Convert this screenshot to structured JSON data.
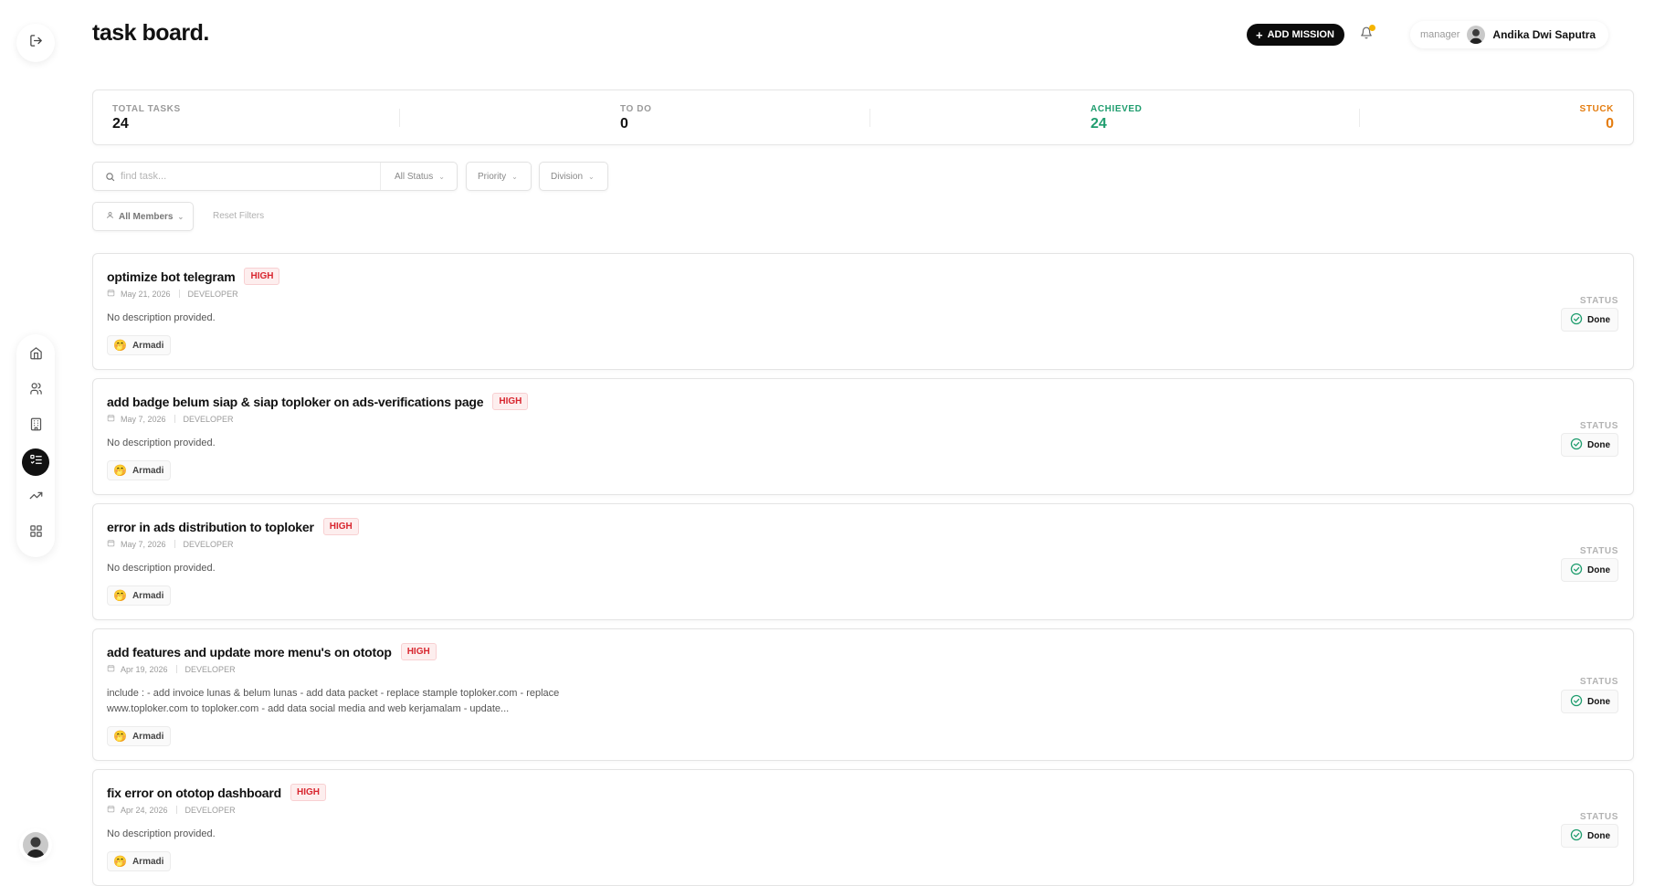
{
  "header": {
    "title": "task board.",
    "add_button": "ADD MISSION",
    "user_role": "manager",
    "user_name": "Andika Dwi Saputra"
  },
  "stats": {
    "total_label": "TOTAL TASKS",
    "total_value": "24",
    "todo_label": "TO DO",
    "todo_value": "0",
    "achieved_label": "ACHIEVED",
    "achieved_value": "24",
    "stuck_label": "STUCK",
    "stuck_value": "0"
  },
  "filters": {
    "search_placeholder": "find task...",
    "status": "All Status",
    "priority": "Priority",
    "division": "Division",
    "members": "All Members",
    "reset": "Reset Filters"
  },
  "status_heading": "STATUS",
  "tasks": [
    {
      "title": "optimize bot telegram",
      "priority": "HIGH",
      "date": "May 21, 2026",
      "division": "DEVELOPER",
      "description": "No description provided.",
      "assignee": "Armadi",
      "status": "Done"
    },
    {
      "title": "add badge belum siap & siap toploker on ads-verifications page",
      "priority": "HIGH",
      "date": "May 7, 2026",
      "division": "DEVELOPER",
      "description": "No description provided.",
      "assignee": "Armadi",
      "status": "Done"
    },
    {
      "title": "error in ads distribution to toploker",
      "priority": "HIGH",
      "date": "May 7, 2026",
      "division": "DEVELOPER",
      "description": "No description provided.",
      "assignee": "Armadi",
      "status": "Done"
    },
    {
      "title": "add features and update more menu's on ototop",
      "priority": "HIGH",
      "date": "Apr 19, 2026",
      "division": "DEVELOPER",
      "description": "include : - add invoice lunas & belum lunas - add data packet - replace stample toploker.com - replace www.toploker.com to toploker.com - add data social media and web kerjamalam - update...",
      "assignee": "Armadi",
      "status": "Done"
    },
    {
      "title": "fix error on ototop dashboard",
      "priority": "HIGH",
      "date": "Apr 24, 2026",
      "division": "DEVELOPER",
      "description": "No description provided.",
      "assignee": "Armadi",
      "status": "Done"
    }
  ],
  "colors": {
    "accent": "#0b0b0b",
    "achieved": "#1f9d6e",
    "stuck": "#e47d10",
    "high": "#d8262f",
    "done": "#1f9d6e",
    "notification": "#f5b400"
  },
  "icons": {
    "logout": "logout-icon",
    "nav": [
      "home-icon",
      "users-icon",
      "building-icon",
      "tasks-icon",
      "trending-icon",
      "grid-icon"
    ],
    "bell": "bell-icon",
    "search": "search-icon",
    "calendar": "calendar-icon",
    "status": "check-circle-icon",
    "assignee": "emoji-avatar-icon"
  }
}
